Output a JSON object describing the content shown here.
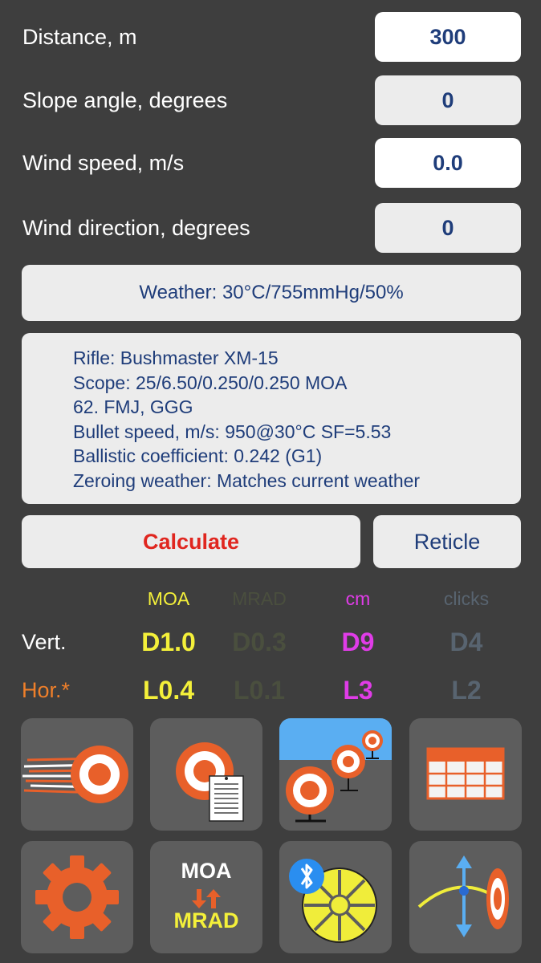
{
  "inputs": [
    {
      "label": "Distance, m",
      "value": "300"
    },
    {
      "label": "Slope angle, degrees",
      "value": "0"
    },
    {
      "label": "Wind speed, m/s",
      "value": "0.0"
    },
    {
      "label": "Wind direction, degrees",
      "value": "0"
    }
  ],
  "weather": "Weather: 30°C/755mmHg/50%",
  "rifle": [
    "Rifle: Bushmaster XM-15",
    "Scope: 25/6.50/0.250/0.250 MOA",
    "62. FMJ, GGG",
    "Bullet speed, m/s: 950@30°C SF=5.53",
    "Ballistic coefficient: 0.242 (G1)",
    "Zeroing weather: Matches current weather"
  ],
  "buttons": {
    "calculate": "Calculate",
    "reticle": "Reticle"
  },
  "units": {
    "moa": "MOA",
    "mrad": "MRAD",
    "cm": "cm",
    "clicks": "clicks"
  },
  "rows": {
    "vert": "Vert.",
    "hor": "Hor.*"
  },
  "results": {
    "vert": {
      "moa": "D1.0",
      "mrad": "D0.3",
      "cm": "D9",
      "clicks": "D4"
    },
    "hor": {
      "moa": "L0.4",
      "mrad": "L0.1",
      "cm": "L3",
      "clicks": "L2"
    }
  },
  "tiles": {
    "convert_top": "MOA",
    "convert_bottom": "MRAD",
    "icons": [
      "shot-target-icon",
      "target-notes-icon",
      "range-targets-icon",
      "table-icon",
      "settings-gear-icon",
      "moa-mrad-convert-icon",
      "bluetooth-anemometer-icon",
      "trajectory-icon"
    ]
  },
  "colors": {
    "background": "#3e3e3e",
    "moa": "#f4f03a",
    "mrad": "#4a4f3e",
    "cm": "#e03ce8",
    "clicks": "#586470",
    "hor_label": "#ef7f2a",
    "calculate": "#e0261f",
    "field_text": "#1f3d7a"
  }
}
